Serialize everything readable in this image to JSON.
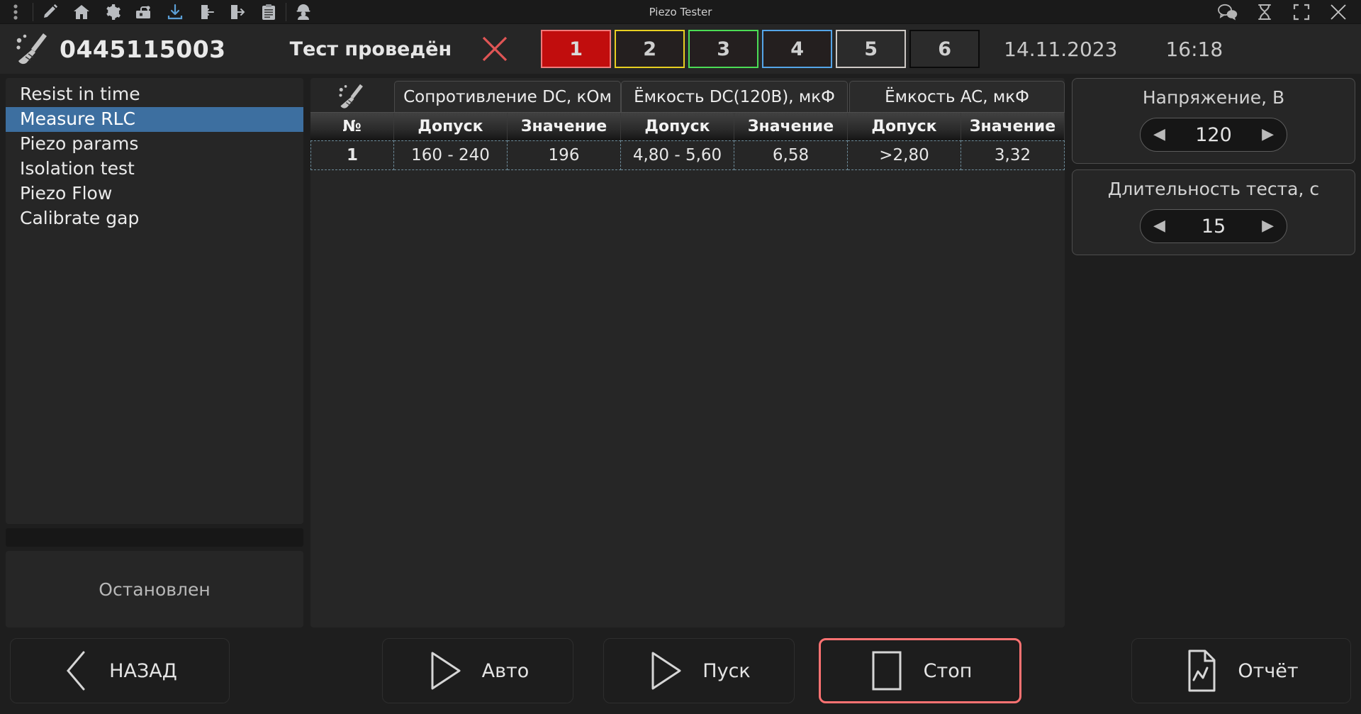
{
  "window": {
    "title": "Piezo Tester",
    "toolbar_icons": [
      {
        "name": "more-vert-icon"
      },
      {
        "name": "pencil-icon"
      },
      {
        "name": "home-icon"
      },
      {
        "name": "gear-icon"
      },
      {
        "name": "toolbox-icon"
      },
      {
        "name": "download-icon"
      },
      {
        "name": "import-icon"
      },
      {
        "name": "export-icon"
      },
      {
        "name": "clipboard-icon"
      },
      {
        "name": "worker-icon"
      }
    ],
    "controls": [
      {
        "name": "chat-icon"
      },
      {
        "name": "hourglass-icon"
      },
      {
        "name": "fullscreen-icon"
      },
      {
        "name": "close-icon"
      }
    ]
  },
  "header": {
    "broom_icon": "broom-icon",
    "part_number": "0445115003",
    "test_status": "Тест проведён",
    "clear_icon": "x-icon",
    "position_buttons": [
      {
        "label": "1",
        "state": "fail-active",
        "color": "#c10d0d"
      },
      {
        "label": "2",
        "state": "warn",
        "color": "#e8cf21"
      },
      {
        "label": "3",
        "state": "pass",
        "color": "#4bdc55"
      },
      {
        "label": "4",
        "state": "info",
        "color": "#55a5e8"
      },
      {
        "label": "5",
        "state": "idle",
        "color": "#cfcac6"
      },
      {
        "label": "6",
        "state": "disabled",
        "color": "#0a0a0a"
      }
    ],
    "date": "14.11.2023",
    "time": "16:18"
  },
  "sidebar": {
    "items": [
      {
        "label": "Resist in time",
        "selected": false
      },
      {
        "label": "Measure RLC",
        "selected": true
      },
      {
        "label": "Piezo params",
        "selected": false
      },
      {
        "label": "Isolation test",
        "selected": false
      },
      {
        "label": "Piezo Flow",
        "selected": false
      },
      {
        "label": "Calibrate gap",
        "selected": false
      }
    ],
    "progress_value": 0,
    "status_text": "Остановлен"
  },
  "table": {
    "broom_icon": "broom-icon",
    "column_groups": [
      {
        "label": "Сопротивление DC, кОм"
      },
      {
        "label": "Ёмкость DC(120В), мкФ"
      },
      {
        "label": "Ёмкость AC, мкФ"
      }
    ],
    "headers": [
      "№",
      "Допуск",
      "Значение",
      "Допуск",
      "Значение",
      "Допуск",
      "Значение"
    ],
    "rows": [
      {
        "no": "1",
        "tol_dc_res": "160 - 240",
        "val_dc_res": "196",
        "tol_cap_dc": "4,80 - 5,60",
        "val_cap_dc": "6,58",
        "tol_cap_ac": ">2,80",
        "val_cap_ac": "3,32"
      }
    ]
  },
  "params": {
    "voltage": {
      "label": "Напряжение, В",
      "value": "120",
      "dec_icon": "left-arrow-icon",
      "inc_icon": "right-arrow-icon"
    },
    "duration": {
      "label": "Длительность теста, с",
      "value": "15",
      "dec_icon": "left-arrow-icon",
      "inc_icon": "right-arrow-icon"
    }
  },
  "footer": {
    "back": {
      "label": "НАЗАД",
      "icon": "chevron-left-icon"
    },
    "auto": {
      "label": "Авто",
      "icon": "play-icon"
    },
    "start": {
      "label": "Пуск",
      "icon": "play-icon"
    },
    "stop": {
      "label": "Стоп",
      "icon": "stop-square-icon",
      "highlight_color": "#ff7272"
    },
    "report": {
      "label": "Отчёт",
      "icon": "chart-document-icon"
    }
  }
}
